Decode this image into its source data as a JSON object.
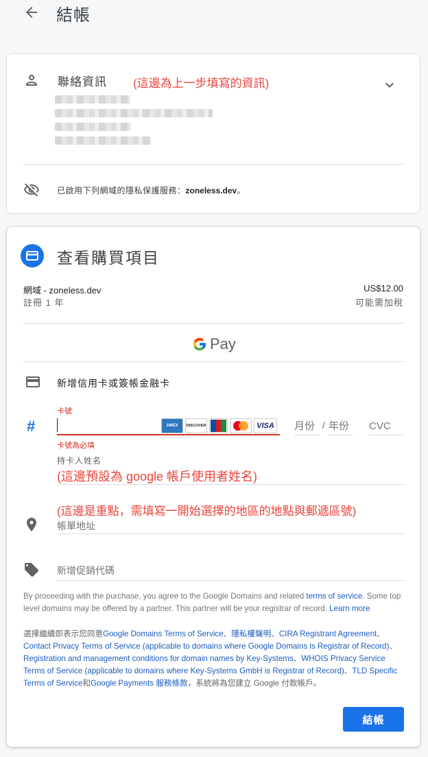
{
  "header": {
    "title": "結帳"
  },
  "contact": {
    "title": "聯絡資訊",
    "annotation": "(這邊為上一步填寫的資訊)",
    "privacy_prefix": "已啟用下列網域的隱私保護服務：",
    "privacy_domain": "zoneless.dev",
    "privacy_suffix": "。"
  },
  "review": {
    "title": "查看購買項目",
    "item_name": "網域 - zoneless.dev",
    "item_term": "註冊 1 年",
    "item_price": "US$12.00",
    "item_tax": "可能需加稅",
    "gpay_label": "Pay"
  },
  "payment": {
    "add_card_label": "新增信用卡或簽帳金融卡",
    "card_number_label": "卡號",
    "card_number_error": "卡號為必填",
    "card_brands": [
      "AMEX",
      "DISCOVER",
      "JCB",
      "MasterCard",
      "VISA"
    ],
    "month_placeholder": "月份",
    "separator": "/",
    "year_placeholder": "年份",
    "cvc_placeholder": "CVC",
    "holder_label": "持卡人姓名",
    "holder_annotation": "(這邊預設為 google 帳戶使用者姓名)",
    "address_annotation": "(這邊是重點，需填寫一開始選擇的地區的地點與郵遞區號)",
    "address_placeholder": "帳單地址",
    "promo_placeholder": "新增促銷代碼"
  },
  "legal": {
    "p1_text": "By proceeding with the purchase, you agree to the Google Domains and related ",
    "p1_link1": "terms of service",
    "p1_mid": ". Some top level domains may be offered by a partner. This partner will be your registrar of record. ",
    "p1_link2": "Learn more",
    "p2_prefix": "選擇繼續即表示您同意",
    "p2_link1": "Google Domains Terms of Service",
    "p2_sep1": "、",
    "p2_link2": "隱私權聲明",
    "p2_sep2": "、",
    "p2_link3": "CIRA Registrant Agreement",
    "p2_sep3": "、",
    "p2_link4": "Contact Privacy Terms of Service (applicable to domains where Google Domains is Registrar of Record)",
    "p2_sep4": "、",
    "p2_link5": "Registration and management conditions for domain names by Key-Systems",
    "p2_sep5": "、",
    "p2_link6": "WHOIS Privacy Service Terms of Service (applicable to domains where Key-Systems GmbH is Registrar of Record)",
    "p2_sep6": "、",
    "p2_link7": "TLD Specific Terms of Service",
    "p2_and": "和",
    "p2_link8": "Google Payments 服務條款",
    "p2_suffix": "，系統將為您建立 Google 付款帳戶。"
  },
  "actions": {
    "checkout_label": "結帳"
  },
  "colors": {
    "accent": "#1a73e8",
    "error": "#d93025",
    "annotation": "#e8453c"
  }
}
